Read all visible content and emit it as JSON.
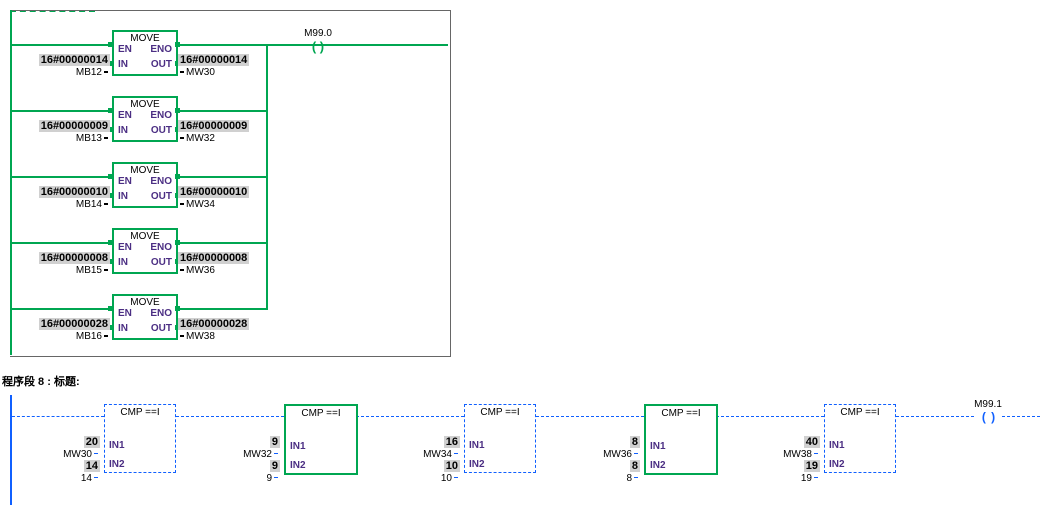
{
  "network7": {
    "coil_addr": "M99.0",
    "coil_glyph": "( )",
    "blocks": [
      {
        "title": "MOVE",
        "en": "EN",
        "eno": "ENO",
        "inport": "IN",
        "outport": "OUT",
        "in_hex": "16#00000014",
        "in_sym": "MB12",
        "out_hex": "16#00000014",
        "out_sym": "MW30"
      },
      {
        "title": "MOVE",
        "en": "EN",
        "eno": "ENO",
        "inport": "IN",
        "outport": "OUT",
        "in_hex": "16#00000009",
        "in_sym": "MB13",
        "out_hex": "16#00000009",
        "out_sym": "MW32"
      },
      {
        "title": "MOVE",
        "en": "EN",
        "eno": "ENO",
        "inport": "IN",
        "outport": "OUT",
        "in_hex": "16#00000010",
        "in_sym": "MB14",
        "out_hex": "16#00000010",
        "out_sym": "MW34"
      },
      {
        "title": "MOVE",
        "en": "EN",
        "eno": "ENO",
        "inport": "IN",
        "outport": "OUT",
        "in_hex": "16#00000008",
        "in_sym": "MB15",
        "out_hex": "16#00000008",
        "out_sym": "MW36"
      },
      {
        "title": "MOVE",
        "en": "EN",
        "eno": "ENO",
        "inport": "IN",
        "outport": "OUT",
        "in_hex": "16#00000028",
        "in_sym": "MB16",
        "out_hex": "16#00000028",
        "out_sym": "MW38"
      }
    ]
  },
  "network8": {
    "label": "程序段  8 : 标题:",
    "coil_addr": "M99.1",
    "coil_glyph": "( )",
    "blocks": [
      {
        "title": "CMP ==I",
        "on": false,
        "in1port": "IN1",
        "in2port": "IN2",
        "in1_val": "20",
        "in1_sym": "MW30",
        "in2_val": "14",
        "in2_sym": "14"
      },
      {
        "title": "CMP ==I",
        "on": true,
        "in1port": "IN1",
        "in2port": "IN2",
        "in1_val": "9",
        "in1_sym": "MW32",
        "in2_val": "9",
        "in2_sym": "9"
      },
      {
        "title": "CMP ==I",
        "on": false,
        "in1port": "IN1",
        "in2port": "IN2",
        "in1_val": "16",
        "in1_sym": "MW34",
        "in2_val": "10",
        "in2_sym": "10"
      },
      {
        "title": "CMP ==I",
        "on": true,
        "in1port": "IN1",
        "in2port": "IN2",
        "in1_val": "8",
        "in1_sym": "MW36",
        "in2_val": "8",
        "in2_sym": "8"
      },
      {
        "title": "CMP ==I",
        "on": false,
        "in1port": "IN1",
        "in2port": "IN2",
        "in1_val": "40",
        "in1_sym": "MW38",
        "in2_val": "19",
        "in2_sym": "19"
      }
    ]
  }
}
